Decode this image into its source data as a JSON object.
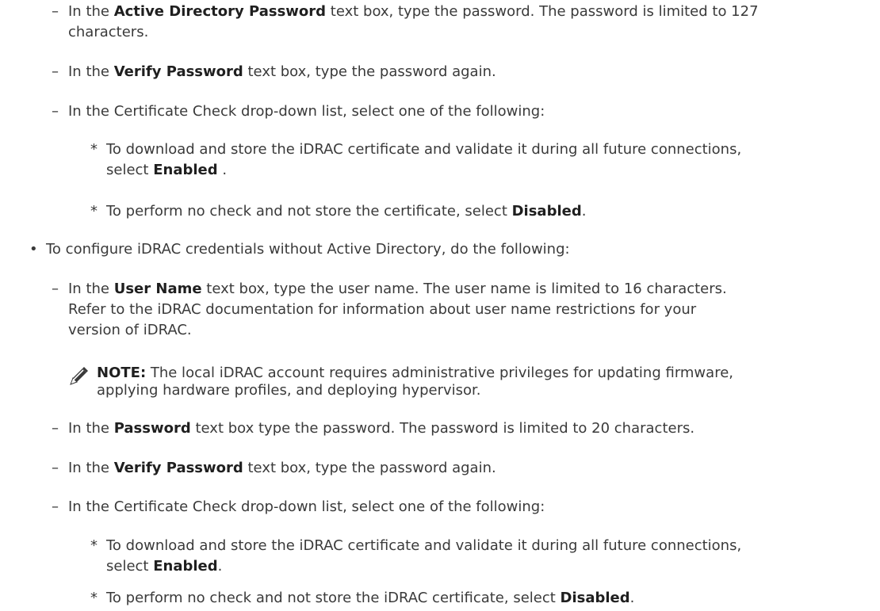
{
  "section_active_directory": {
    "items": [
      {
        "marker": "–",
        "before": "In the ",
        "bold": "Active Directory Password",
        "after": " text box, type the password. The password is limited to 127",
        "line2": "characters."
      },
      {
        "marker": "–",
        "before": "In the ",
        "bold": "Verify Password",
        "after": " text box, type the password again."
      },
      {
        "marker": "–",
        "text": "In the Certificate Check drop-down list, select one of the following:"
      }
    ],
    "sub_items": [
      {
        "marker": "*",
        "line1": "To download and store the iDRAC certificate and validate it during all future connections,",
        "before": "select ",
        "bold": "Enabled",
        "after": " ."
      },
      {
        "marker": "*",
        "before": "To perform no check and not store the certificate, select ",
        "bold": "Disabled",
        "after": "."
      }
    ]
  },
  "bullet_no_ad": {
    "marker": "•",
    "text": "To configure iDRAC credentials without Active Directory, do the following:"
  },
  "section_no_ad": {
    "user_name_item": {
      "marker": "–",
      "before": "In the ",
      "bold": "User Name",
      "after": " text box, type the user name. The user name is limited to 16 characters.",
      "line2": "Refer to the iDRAC documentation for information about user name restrictions for your",
      "line3": "version of iDRAC."
    },
    "note": {
      "icon": "pencil-note-icon",
      "label": "NOTE:",
      "line1": " The local iDRAC account requires administrative privileges for updating firmware,",
      "line2": "applying hardware profiles, and deploying hypervisor."
    },
    "items": [
      {
        "marker": "–",
        "before": "In the ",
        "bold": "Password",
        "after": " text box type the password. The password is limited to 20 characters."
      },
      {
        "marker": "–",
        "before": "In the ",
        "bold": "Verify Password",
        "after": " text box, type the password again."
      },
      {
        "marker": "–",
        "text": "In the Certificate Check drop-down list, select one of the following:"
      }
    ],
    "sub_items": [
      {
        "marker": "*",
        "line1": "To download and store the iDRAC certificate and validate it during all future connections,",
        "before": "select ",
        "bold": "Enabled",
        "after": "."
      },
      {
        "marker": "*",
        "before": "To perform no check and not store the iDRAC certificate, select ",
        "bold": "Disabled",
        "after": "."
      }
    ]
  }
}
